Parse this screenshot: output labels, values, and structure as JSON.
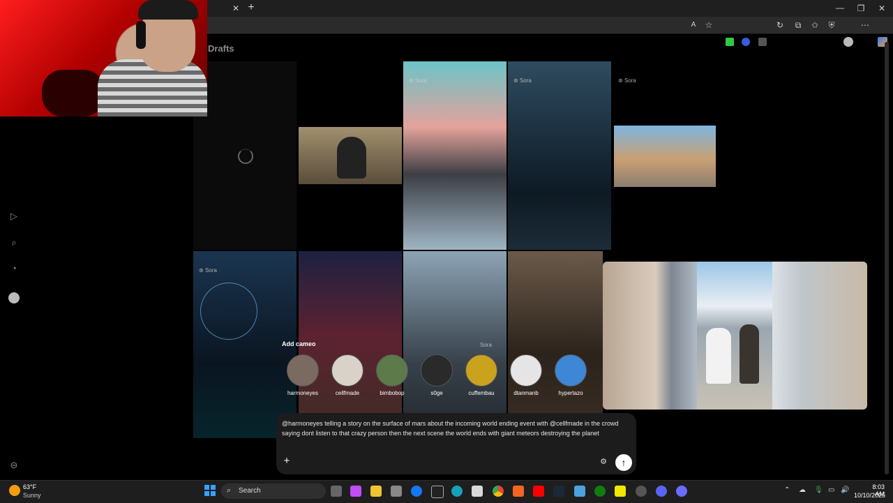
{
  "browser": {
    "new_tab_icon": "plus-icon",
    "close_tab_icon": "close-icon",
    "window_controls": [
      "minimize-icon",
      "restore-icon",
      "close-icon"
    ]
  },
  "page": {
    "title": "Drafts"
  },
  "sidebar": {
    "icons": [
      "video-icon",
      "search-icon",
      "bell-icon",
      "avatar-icon",
      "collapse-icon"
    ]
  },
  "tiles": {
    "sora_label": "Sora"
  },
  "cameo": {
    "label": "Add cameo",
    "people": [
      {
        "name": "harmoneyes",
        "color": "#7b6a60"
      },
      {
        "name": "cellfmade",
        "color": "#d8d2c8"
      },
      {
        "name": "bimbobop",
        "color": "#5c7a4a"
      },
      {
        "name": "s0ge",
        "color": "#2a2a2a"
      },
      {
        "name": "cuffembau",
        "color": "#c9a21e"
      },
      {
        "name": "dtanmanb",
        "color": "#e5e5e5"
      },
      {
        "name": "hypertazo",
        "color": "#3d87d6"
      }
    ]
  },
  "prompt": {
    "text": "@harmoneyes telling a story on the surface of mars about the incoming world ending event with @cellfmade in the crowd saying dont listen to that crazy person then the next scene the world ends with giant meteors destroying the planet",
    "add_icon": "plus-icon",
    "settings_icon": "sliders-icon",
    "send_icon": "arrow-up-icon"
  },
  "taskbar": {
    "weather_temp": "63°F",
    "weather_text": "Sunny",
    "search_label": "Search",
    "time": "8:03 AM",
    "date": "10/10/2025"
  },
  "colors": {
    "accent": "#ffffff",
    "background": "#000000",
    "prompt_bg": "#1c1c1c"
  }
}
